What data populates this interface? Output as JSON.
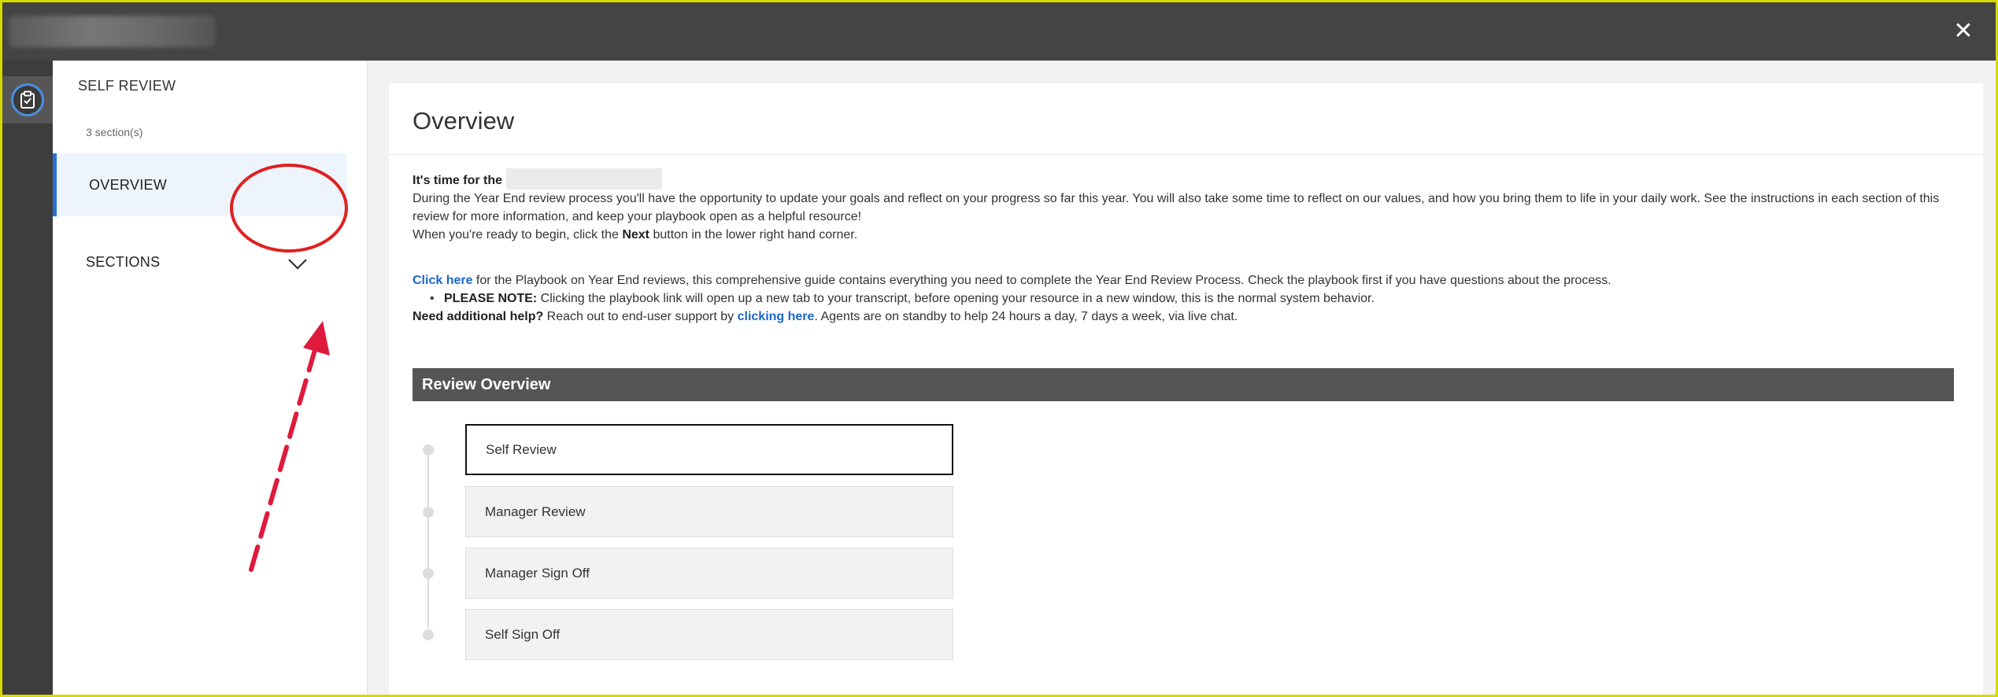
{
  "window": {
    "close_icon": "close-icon"
  },
  "rail": {
    "icon": "clipboard-check-icon"
  },
  "sidebar": {
    "title": "SELF REVIEW",
    "section_count": "3 section(s)",
    "overview_label": "OVERVIEW",
    "sections_label": "SECTIONS",
    "chevron_icon": "chevron-down-icon"
  },
  "main": {
    "title": "Overview",
    "intro": {
      "time_for": "It's time for the",
      "description": "During the Year End review process you'll have the opportunity to update your goals and reflect on your progress so far this year. You will also take some time to reflect on our values, and how you bring them to life in your daily work. See the instructions in each section of this review for more information, and keep your playbook open as a helpful resource!",
      "ready_prefix": "When you're ready to begin, click the ",
      "ready_bold": "Next",
      "ready_suffix": " button in the lower right hand corner.",
      "click_here": "Click here",
      "playbook_text": " for the Playbook on Year End reviews, this comprehensive guide contains everything you need to complete the Year End Review Process. Check the playbook first if you have questions about the process.",
      "note_label": "PLEASE NOTE:",
      "note_text": " Clicking the playbook link will open up a new tab to your transcript, before opening your resource in a new window, this is the normal system behavior.",
      "help_label": "Need additional help?",
      "help_prefix": " Reach out to end-user support by ",
      "help_link": "clicking here",
      "help_suffix": ". Agents are on standby to help 24 hours a day, 7 days a week, via live chat."
    },
    "review_overview_title": "Review Overview",
    "steps": [
      {
        "label": "Self Review",
        "active": true
      },
      {
        "label": "Manager Review",
        "active": false
      },
      {
        "label": "Manager Sign Off",
        "active": false
      },
      {
        "label": "Self Sign Off",
        "active": false
      }
    ]
  },
  "colors": {
    "accent": "#2a6fd6",
    "link": "#1a66cc",
    "annotation": "#e02020",
    "topbar": "#444444",
    "outer_border": "#d8d800"
  }
}
